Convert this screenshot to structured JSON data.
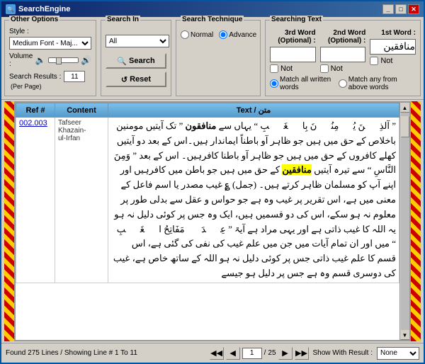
{
  "window": {
    "title": "SearchEngine"
  },
  "other_options": {
    "label": "Other Options",
    "style_label": "Style :",
    "style_value": "Medium Font - Maj...",
    "volume_label": "Volume :",
    "search_results_label": "Search Results :",
    "per_page_label": "(Per Page)",
    "search_results_value": "11"
  },
  "search_in": {
    "label": "Search In",
    "value": "All"
  },
  "search_technique": {
    "label": "Search Technique",
    "normal_label": "Normal",
    "advance_label": "Advance"
  },
  "searching_text": {
    "label": "Searching Text",
    "col3_label": "3rd Word (Optional) :",
    "col2_label": "2nd Word (Optional) :",
    "col1_label": "1st Word :",
    "col1_value": "منافقین",
    "col2_value": "",
    "col3_value": "",
    "not1_label": "Not",
    "not2_label": "Not",
    "not3_label": "Not",
    "match_all_label": "Match all written words",
    "match_any_label": "Match any from above words"
  },
  "buttons": {
    "search_label": "Search",
    "reset_label": "Reset"
  },
  "table": {
    "col_ref": "Ref #",
    "col_content": "Content",
    "col_text": "Text / متن",
    "rows": [
      {
        "ref": "002.003",
        "content_line1": "Tafseer",
        "content_line2": "Khazain-",
        "content_line3": "ul-Irfan",
        "text": "\" آلذِیۡنَ یُؤۡمِنُوۡنَ بِالۡغَیۡبِ \" یہاں سے منافقون \" تک آیتیں مومنین باخلاص کے حق میں ہیں جو ظاہر آو باطناً ایماندار ہیں۔اس کے بعد دو آیتیں کھلے کافروں کے حق میں ہیں جو ظاہر آو باطنا کافرہیں۔ اس کے بعد \" وَمِنَ النَّاسِ \" سے تیرہ آیتیں منافقین کے حق میں ہیں جو باطن میں کافرہیں اور اپنے آپ کو مسلمان ظاہر کرتے ہیں۔ (جمل) ؏ غیب مصدر یا اسم فاعل کے معنی میں ہے، اس تقریر پر غیب وہ ہے جو حواس و عقل سے بدلی طور پر معلوم نہ ہو سکے، اس کی دو قسمیں ہیں، ایک وہ جس پر کوئی دلیل نہ ہو یہ اللہ کا غیب ذاتی ہے اور یہی مراد ہے آیۃ \" عِنۡدَہٗ مَفَاتِحُ الۡغَیۡبِ \" میں اور ان تمام آیات میں جن میں علم غیب کی نفی کی گئی ہے، اس قسم کا علم غیب ذاتی جس پر کوئی دلیل نہ ہو اللہ کے ساتھ خاص ہے، غیب کی دوسری قسم وہ ہے جس پر دلیل ہو جیسے"
      }
    ]
  },
  "status": {
    "found_text": "Found 275 Lines / Showing Line # 1 To 11",
    "page_current": "1",
    "page_total": "25",
    "show_result_label": "Show With Result :",
    "show_result_value": "None"
  },
  "nav_buttons": {
    "first": "◀◀",
    "prev": "◀",
    "next": "▶",
    "last": "▶▶"
  }
}
